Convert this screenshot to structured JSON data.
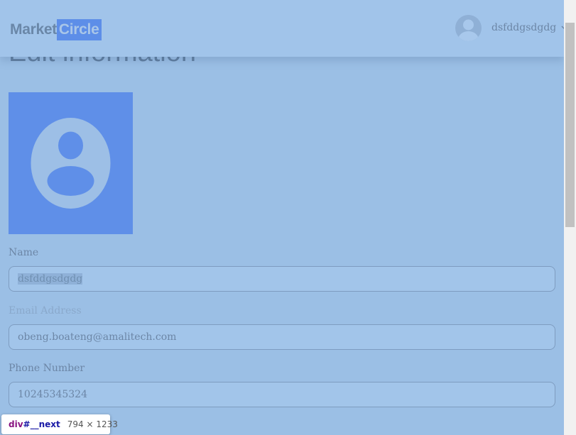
{
  "header": {
    "logo": {
      "part1": "Market",
      "part2": "Circle"
    },
    "user": {
      "name": "dsfddgsdgdg"
    }
  },
  "page": {
    "title": "Edit information"
  },
  "form": {
    "name": {
      "label": "Name",
      "value": "dsfddgsdgdg"
    },
    "email": {
      "label": "Email Address",
      "value": "obeng.boateng@amalitech.com"
    },
    "phone": {
      "label": "Phone Number",
      "value": "10245345324"
    }
  },
  "devtools_tooltip": {
    "element": "div",
    "id": "#__next",
    "size": "794 × 1233"
  },
  "colors": {
    "brand_blue": "#5f8fe8",
    "overlay": "#9bbfe5",
    "text": "#6c86a6"
  },
  "icons": [
    "user-avatar-icon",
    "chevron-down-icon",
    "profile-placeholder-icon"
  ]
}
